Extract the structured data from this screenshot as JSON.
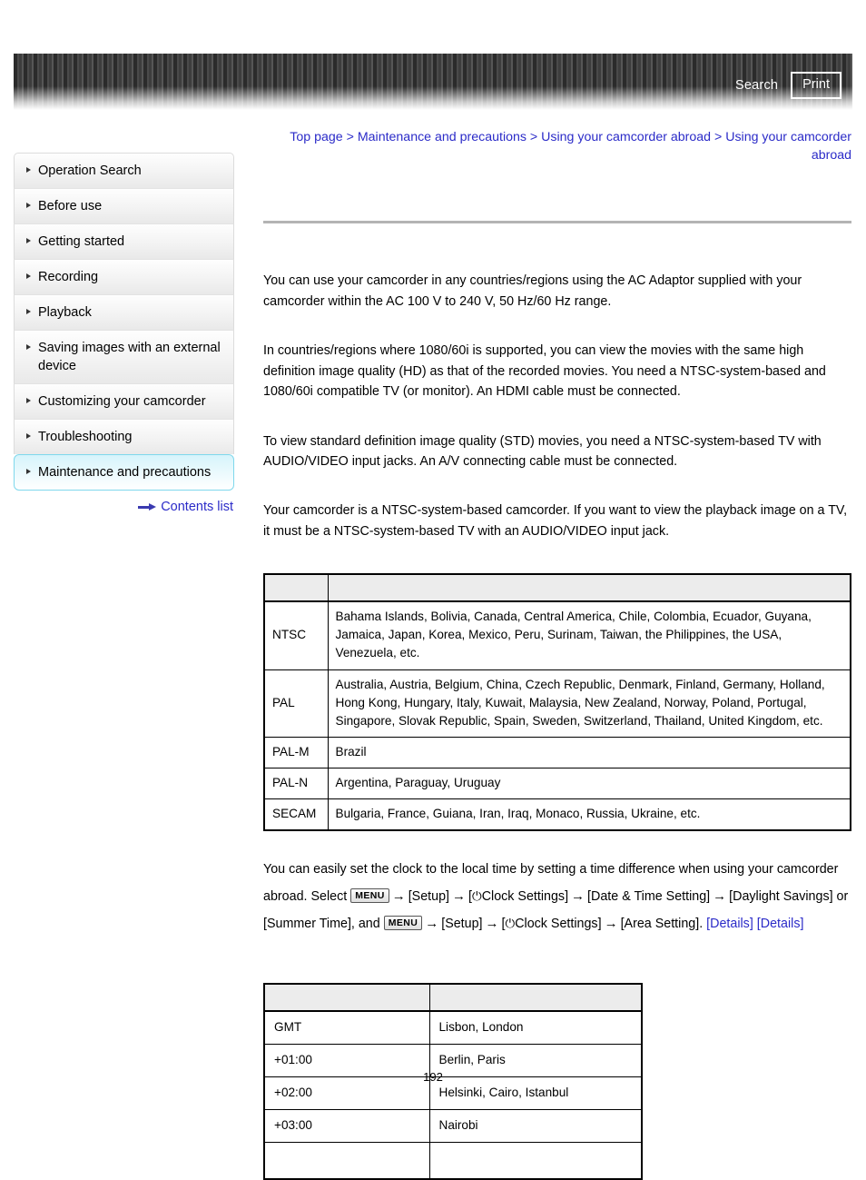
{
  "header": {
    "search_label": "Search",
    "print_label": "Print"
  },
  "breadcrumb": {
    "items": [
      "Top page",
      "Maintenance and precautions",
      "Using your camcorder abroad",
      "Using your camcorder abroad"
    ],
    "separator": ">"
  },
  "sidebar": {
    "items": [
      {
        "label": "Operation Search",
        "selected": false
      },
      {
        "label": "Before use",
        "selected": false
      },
      {
        "label": "Getting started",
        "selected": false
      },
      {
        "label": "Recording",
        "selected": false
      },
      {
        "label": "Playback",
        "selected": false
      },
      {
        "label": "Saving images with an external device",
        "selected": false
      },
      {
        "label": "Customizing your camcorder",
        "selected": false
      },
      {
        "label": "Troubleshooting",
        "selected": false
      },
      {
        "label": "Maintenance and precautions",
        "selected": true
      }
    ],
    "contents_list_label": "Contents list"
  },
  "content": {
    "paragraph_1": "You can use your camcorder in any countries/regions using the AC Adaptor supplied with your camcorder within the AC 100 V to 240 V, 50 Hz/60 Hz range.",
    "paragraph_2": "In countries/regions where 1080/60i is supported, you can view the movies with the same high definition image quality (HD) as that of the recorded movies. You need a NTSC-system-based and 1080/60i compatible TV (or monitor). An HDMI cable must be connected.",
    "paragraph_3": "To view standard definition image quality (STD) movies, you need a NTSC-system-based TV with AUDIO/VIDEO input jacks. An A/V connecting cable must be connected.",
    "paragraph_4": "Your camcorder is a NTSC-system-based camcorder. If you want to view the playback image on a TV, it must be a NTSC-system-based TV with an AUDIO/VIDEO input jack.",
    "clock_text": {
      "part_1": "You can easily set the clock to the local time by setting a time difference when using your camcorder abroad. Select",
      "menu_label": "MENU",
      "arrow": "→",
      "setup": "[Setup]",
      "clock_settings": "Clock Settings]",
      "clock_bracket_open": "[",
      "clock_icon": "⏻",
      "date_time_setting": "[Date & Time Setting]",
      "daylight_savings": "[Daylight Savings] or [Summer Time], and",
      "area_setting": "[Area Setting].",
      "details_1": "[Details]",
      "details_2": "[Details]"
    }
  },
  "tv_system_table": {
    "header": [
      "",
      ""
    ],
    "rows": [
      {
        "system": "NTSC",
        "countries": "Bahama Islands, Bolivia, Canada, Central America, Chile, Colombia, Ecuador, Guyana, Jamaica, Japan, Korea, Mexico, Peru, Surinam, Taiwan, the Philippines, the USA, Venezuela, etc."
      },
      {
        "system": "PAL",
        "countries": "Australia, Austria, Belgium, China, Czech Republic, Denmark, Finland, Germany, Holland, Hong Kong, Hungary, Italy, Kuwait, Malaysia, New Zealand, Norway, Poland, Portugal, Singapore, Slovak Republic, Spain, Sweden, Switzerland, Thailand, United Kingdom, etc."
      },
      {
        "system": "PAL-M",
        "countries": "Brazil"
      },
      {
        "system": "PAL-N",
        "countries": "Argentina, Paraguay, Uruguay"
      },
      {
        "system": "SECAM",
        "countries": "Bulgaria, France, Guiana, Iran, Iraq, Monaco, Russia, Ukraine, etc."
      }
    ]
  },
  "timezone_table": {
    "header": [
      "",
      ""
    ],
    "rows": [
      {
        "offset": "GMT",
        "cities": "Lisbon, London"
      },
      {
        "offset": "+01:00",
        "cities": "Berlin, Paris"
      },
      {
        "offset": "+02:00",
        "cities": "Helsinki, Cairo, Istanbul"
      },
      {
        "offset": "+03:00",
        "cities": "Nairobi"
      }
    ]
  },
  "footer": {
    "page_number": "192"
  }
}
